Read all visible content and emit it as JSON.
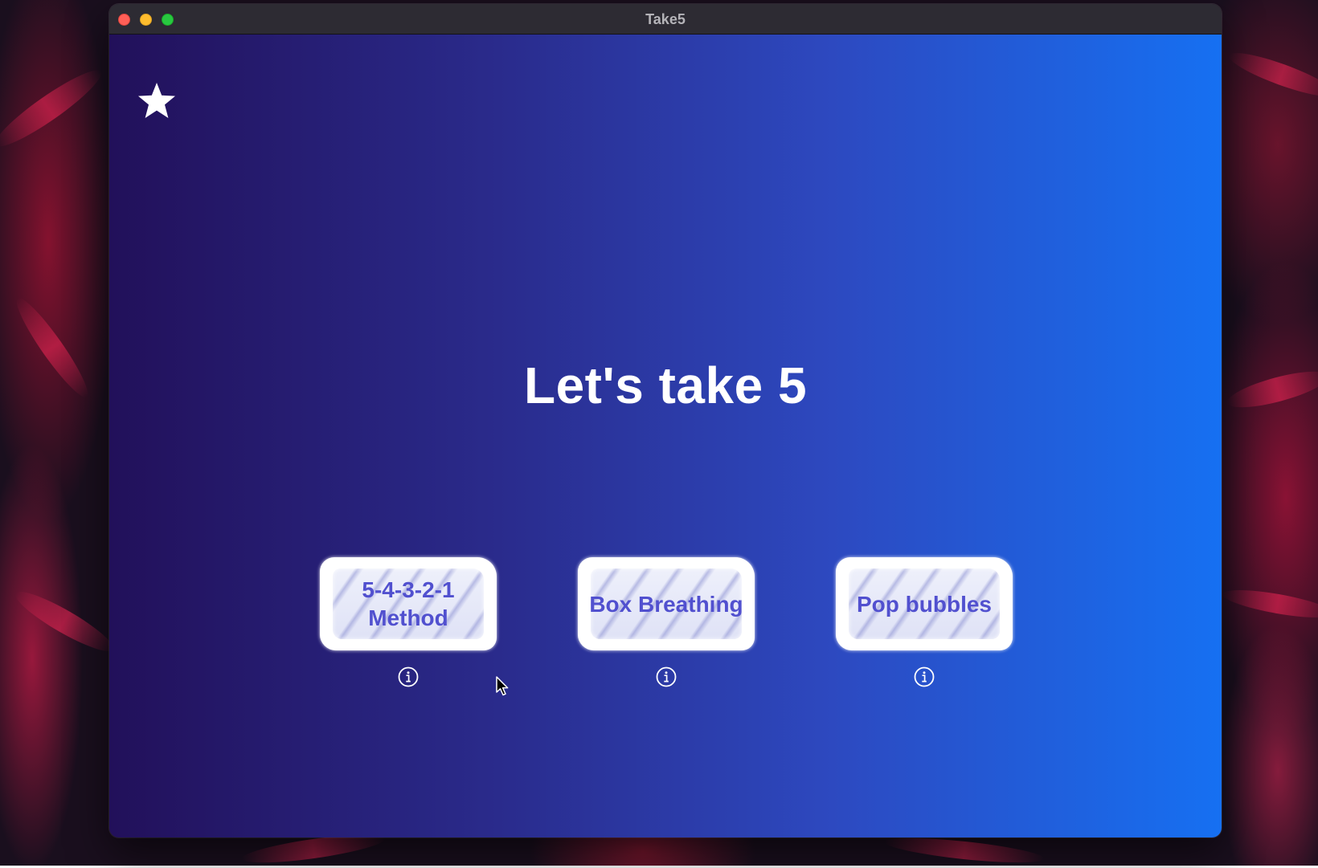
{
  "window": {
    "title": "Take5"
  },
  "main": {
    "heading": "Let's take 5",
    "favorite_icon": "star-icon"
  },
  "options": [
    {
      "label": "5-4-3-2-1\nMethod",
      "info_icon": "info-icon"
    },
    {
      "label": "Box Breathing",
      "info_icon": "info-icon"
    },
    {
      "label": "Pop bubbles",
      "info_icon": "info-icon"
    }
  ],
  "colors": {
    "background_gradient_start": "#22105a",
    "background_gradient_end": "#1670f2",
    "card_text": "#5150cf",
    "title_text": "#ffffff"
  }
}
